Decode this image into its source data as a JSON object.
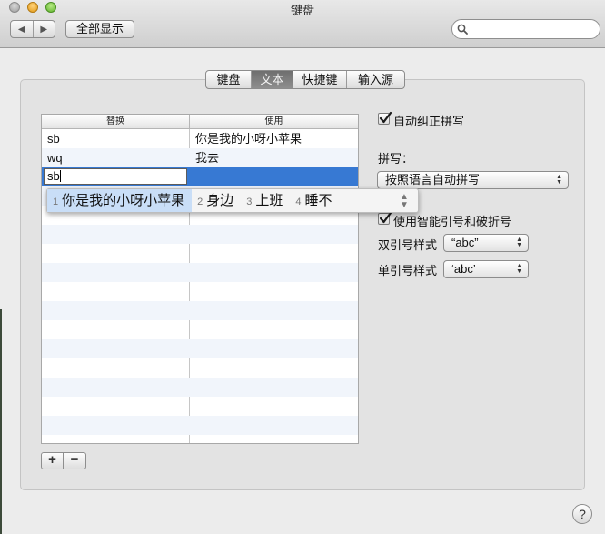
{
  "window": {
    "title": "键盘"
  },
  "toolbar": {
    "back_label": "◀",
    "forward_label": "▶",
    "show_all_label": "全部显示",
    "search_placeholder": "",
    "search_value": ""
  },
  "tabs": [
    {
      "label": "键盘",
      "active": false
    },
    {
      "label": "文本",
      "active": true
    },
    {
      "label": "快捷键",
      "active": false
    },
    {
      "label": "输入源",
      "active": false
    }
  ],
  "table": {
    "col_replace": "替换",
    "col_with": "使用",
    "rows": [
      {
        "replace": "sb",
        "with": "你是我的小呀小苹果"
      },
      {
        "replace": "wq",
        "with": "我去"
      }
    ],
    "editing_row": {
      "replace": "sb",
      "with": ""
    }
  },
  "ime": {
    "candidates": [
      {
        "num": "1",
        "text": "你是我的小呀小苹果",
        "highlighted": true
      },
      {
        "num": "2",
        "text": "身边",
        "highlighted": false
      },
      {
        "num": "3",
        "text": "上班",
        "highlighted": false
      },
      {
        "num": "4",
        "text": "睡不",
        "highlighted": false
      }
    ]
  },
  "buttons": {
    "add": "+",
    "remove": "−",
    "help": "?"
  },
  "settings": {
    "autocorrect_label": "自动纠正拼写",
    "autocorrect_checked": true,
    "spelling_label": "拼写：",
    "spelling_value": "按照语言自动拼写",
    "smart_quotes_label": "使用智能引号和破折号",
    "smart_quotes_checked": true,
    "double_quote_label": "双引号样式",
    "double_quote_value": "“abc”",
    "single_quote_label": "单引号样式",
    "single_quote_value": "‘abc’"
  },
  "colors": {
    "selection": "#3779d3",
    "candidate_highlight": "#c9def7"
  }
}
